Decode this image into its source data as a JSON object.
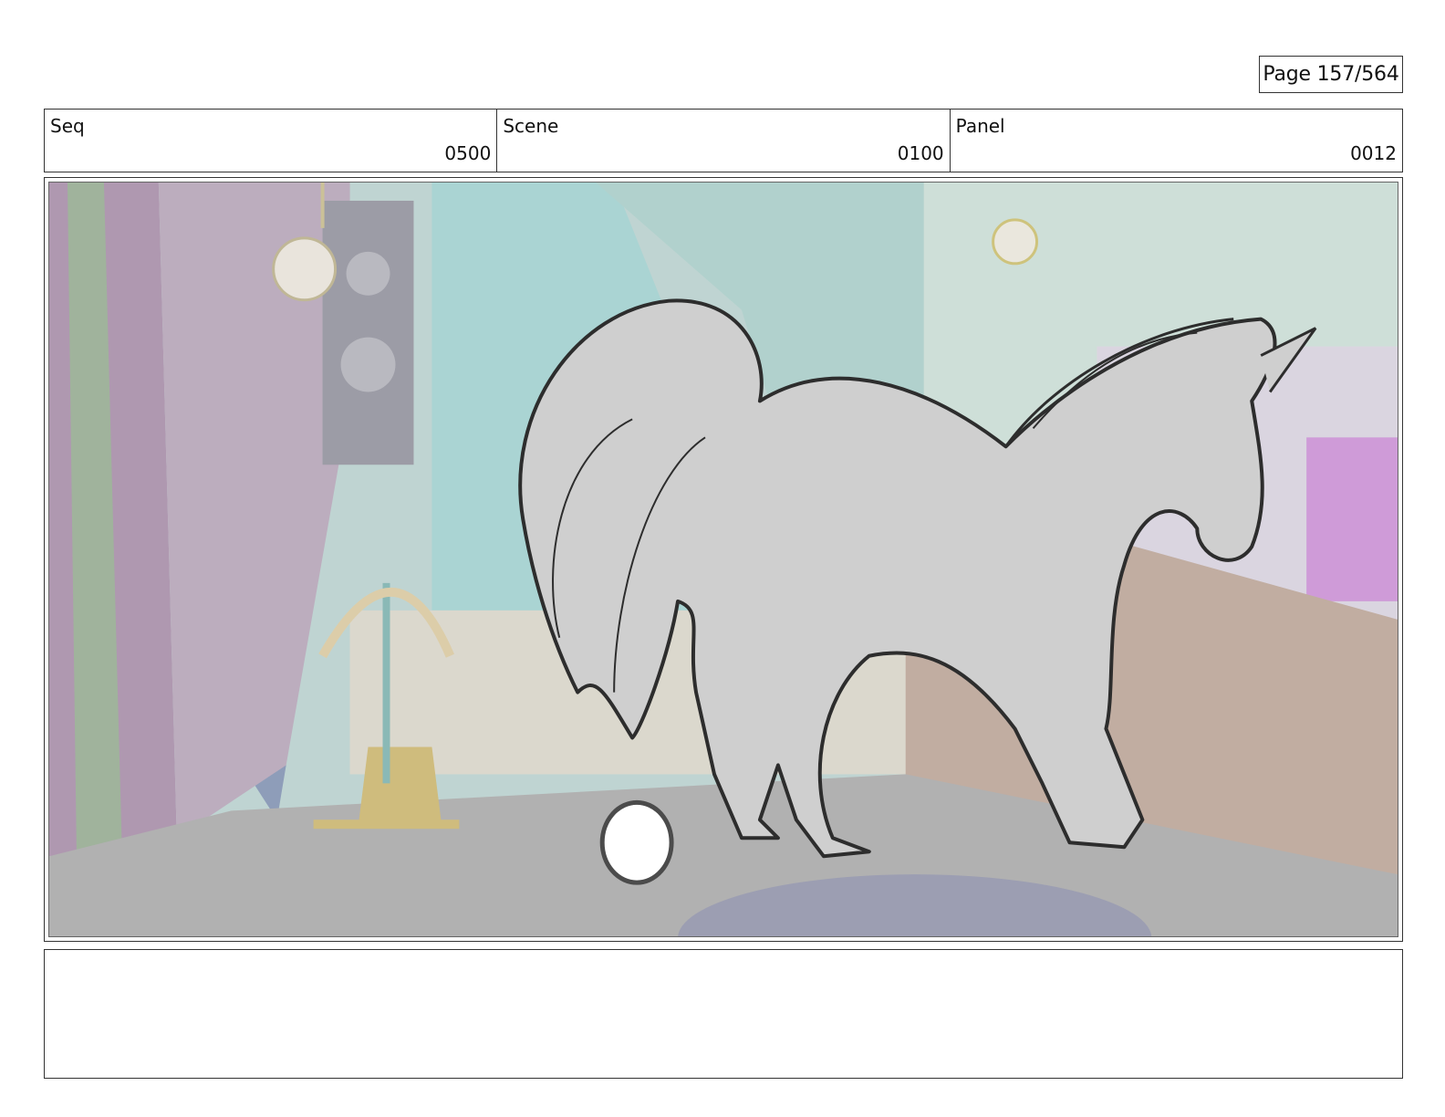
{
  "page": {
    "label": "Page 157/564"
  },
  "header": {
    "seq": {
      "label": "Seq",
      "value": "0500"
    },
    "scene": {
      "label": "Scene",
      "value": "0100"
    },
    "panel": {
      "label": "Panel",
      "value": "0012"
    }
  },
  "artwork": {
    "subject": "unicorn-sketch",
    "colors": {
      "background_teal": "#9fcfcd",
      "floor": "#a7a7a7",
      "curtain_purple": "#a48aa6",
      "wood_brown": "#b9a295",
      "horse_fill": "#c9c9c9",
      "line": "#111111"
    }
  },
  "notes": {
    "text": ""
  }
}
